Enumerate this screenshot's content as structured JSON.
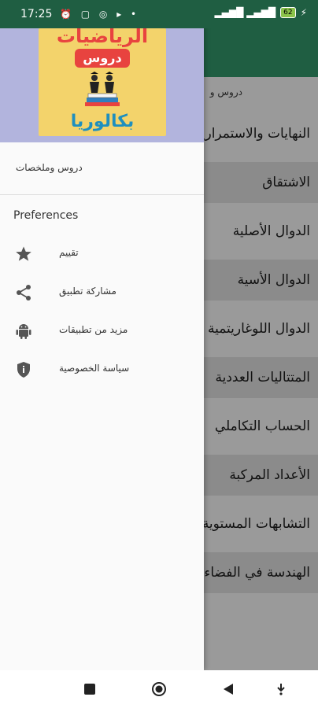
{
  "status": {
    "time": "17:25",
    "icons": "⏰ ▢ ◎ ▸ •",
    "signal": "▂▄▆█ ▂▄▆█",
    "battery": "62"
  },
  "app": {
    "subtitle": "دروس و",
    "rows": [
      "النهايات والاستمرارية",
      "الاشتقاق",
      "الدوال الأصلية",
      "الدوال الأسية",
      "الدوال اللوغاريتمية",
      "المتتاليات العددية",
      "الحساب التكاملي",
      "الأعداد المركبة",
      "التشابهات المستوية",
      "الهندسة في الفضاء"
    ]
  },
  "drawer": {
    "logo": {
      "line1": "الرياضيات",
      "line2": "دروس",
      "line3": "بكالوريا"
    },
    "lessons_label": "دروس وملخصات",
    "prefs_label": "Preferences",
    "items": [
      {
        "label": "تقييم",
        "icon": "star-icon"
      },
      {
        "label": "مشاركة تطبيق",
        "icon": "share-icon"
      },
      {
        "label": "مزيد من تطبيقات",
        "icon": "android-icon"
      },
      {
        "label": "سياسة الخصوصية",
        "icon": "shield-icon"
      }
    ]
  },
  "colors": {
    "primary": "#1f5e42",
    "header": "#b2b4dd",
    "logo_bg": "#f3d36b",
    "accent_red": "#e8433f"
  }
}
